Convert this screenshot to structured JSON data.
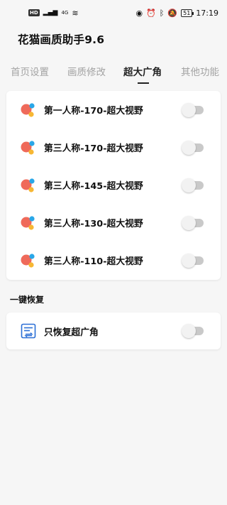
{
  "status_bar": {
    "hd_badge": "HD",
    "network": "4G",
    "battery": "51",
    "time": "17:19"
  },
  "app": {
    "title": "花猫画质助手9.6"
  },
  "tabs": [
    {
      "label": "首页设置",
      "active": false
    },
    {
      "label": "画质修改",
      "active": false
    },
    {
      "label": "超大广角",
      "active": true
    },
    {
      "label": "其他功能",
      "active": false
    }
  ],
  "fov_options": [
    {
      "label": "第一人称-170-超大视野",
      "enabled": false
    },
    {
      "label": "第三人称-170-超大视野",
      "enabled": false
    },
    {
      "label": "第三人称-145-超大视野",
      "enabled": false
    },
    {
      "label": "第三人称-130-超大视野",
      "enabled": false
    },
    {
      "label": "第三人称-110-超大视野",
      "enabled": false
    }
  ],
  "restore_section": {
    "title": "一键恢复",
    "item": {
      "label": "只恢复超广角",
      "enabled": false
    }
  },
  "colors": {
    "bubble_red": "#ef6a5a",
    "bubble_blue": "#2aa7e8",
    "bubble_yellow": "#f7b733",
    "restore_icon": "#2b6fd6",
    "toggle_off": "#c9c9c9"
  }
}
